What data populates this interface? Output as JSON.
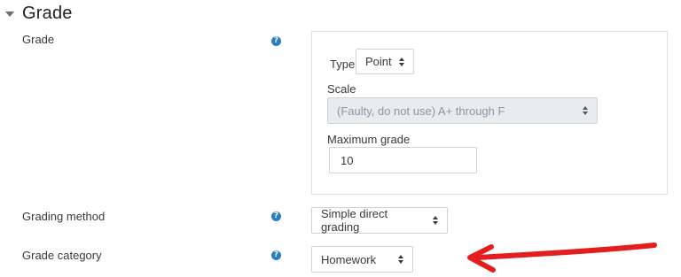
{
  "section": {
    "title": "Grade"
  },
  "grade": {
    "label": "Grade",
    "type_label": "Type",
    "type_value": "Point",
    "scale_label": "Scale",
    "scale_value": "(Faulty, do not use) A+ through F",
    "max_grade_label": "Maximum grade",
    "max_grade_value": "10"
  },
  "grading_method": {
    "label": "Grading method",
    "value": "Simple direct grading"
  },
  "grade_category": {
    "label": "Grade category",
    "value": "Homework"
  },
  "colors": {
    "help_icon": "#2a7fc2",
    "annotation_arrow": "#e31e1e"
  },
  "icons": [
    "collapse-caret-icon",
    "help-icon",
    "select-chevron-icon",
    "red-arrow-annotation"
  ]
}
